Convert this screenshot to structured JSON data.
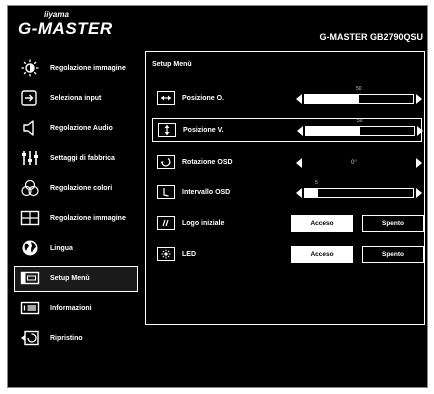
{
  "brand": {
    "small": "iiyama",
    "name": "G-MASTER"
  },
  "model": "G-MASTER GB2790QSU",
  "menu": {
    "items": [
      {
        "label": "Regolazione immagine",
        "icon": "brightness-icon"
      },
      {
        "label": "Seleziona input",
        "icon": "input-icon"
      },
      {
        "label": "Regolazione Audio",
        "icon": "speaker-icon"
      },
      {
        "label": "Settaggi di fabbrica",
        "icon": "sliders-icon"
      },
      {
        "label": "Regolazione colori",
        "icon": "rgb-icon"
      },
      {
        "label": "Regolazione immagine",
        "icon": "screen-icon"
      },
      {
        "label": "Lingua",
        "icon": "globe-icon"
      },
      {
        "label": "Setup Menù",
        "icon": "osd-icon"
      },
      {
        "label": "Informazioni",
        "icon": "info-icon"
      },
      {
        "label": "Ripristino",
        "icon": "reset-icon"
      }
    ],
    "active_index": 7
  },
  "panel": {
    "title": "Setup Menù",
    "rows": [
      {
        "label": "Posizione O.",
        "icon": "h-position-icon",
        "type": "slider",
        "value": 50,
        "max": 100
      },
      {
        "label": "Posizione V.",
        "icon": "v-position-icon",
        "type": "slider",
        "value": 50,
        "max": 100,
        "selected": true
      },
      {
        "label": "Rotazione OSD",
        "icon": "osd-rotation-icon",
        "type": "option",
        "value": "0°"
      },
      {
        "label": "Intervallo OSD",
        "icon": "timer-icon",
        "type": "slider",
        "value": 5,
        "max": 40
      },
      {
        "label": "Logo iniziale",
        "icon": "logo-icon",
        "type": "toggle",
        "on": "Acceso",
        "off": "Spento"
      },
      {
        "label": "LED",
        "icon": "led-icon",
        "type": "toggle",
        "on": "Acceso",
        "off": "Spento"
      }
    ]
  },
  "colors": {
    "background": "#000000",
    "foreground": "#ffffff",
    "page": "#ffffff"
  }
}
